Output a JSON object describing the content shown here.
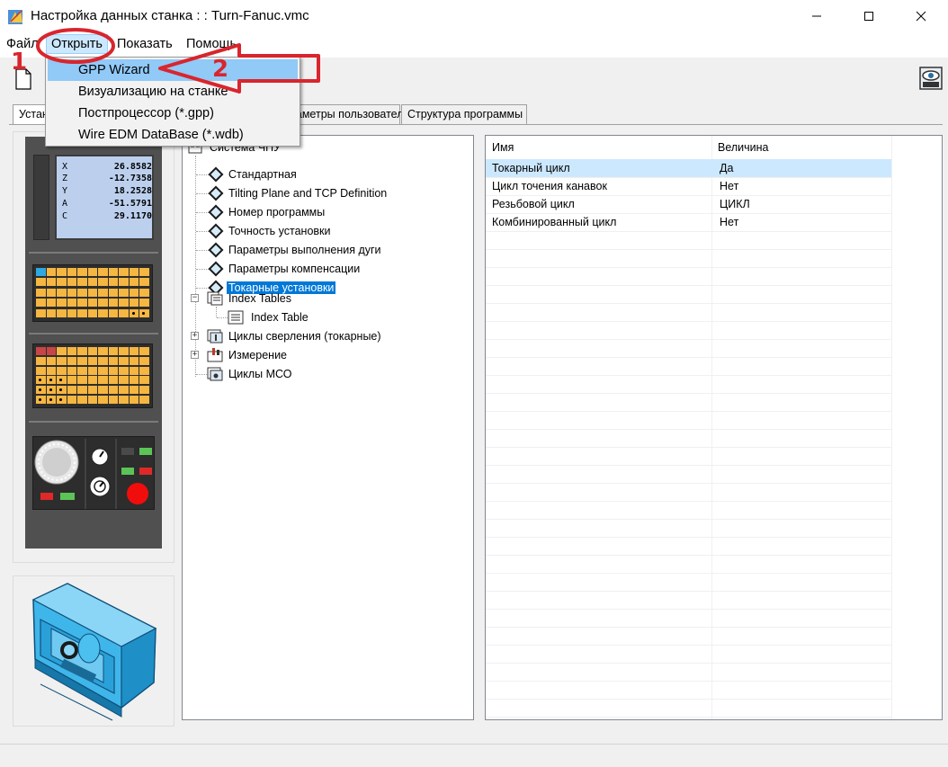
{
  "window": {
    "title": "Настройка данных станка : : Turn-Fanuc.vmc"
  },
  "menu": {
    "file": "Файл",
    "open": "Открыть",
    "show": "Показать",
    "help": "Помощь"
  },
  "dropdown": {
    "items": [
      "GPP Wizard",
      "Визуализацию на станке",
      "Постпроцессор (*.gpp)",
      "Wire EDM DataBase (*.wdb)"
    ]
  },
  "tabs": [
    "Установки",
    "Параметры пользователя",
    "Структура программы"
  ],
  "cnc_readout": [
    {
      "axis": "X",
      "value": "26.8582"
    },
    {
      "axis": "Z",
      "value": "-12.7358"
    },
    {
      "axis": "Y",
      "value": "18.2528"
    },
    {
      "axis": "A",
      "value": "-51.5791"
    },
    {
      "axis": "C",
      "value": "29.1170"
    }
  ],
  "tree": {
    "root": "Система ЧПУ",
    "children": [
      "Стандартная",
      "Tilting Plane and TCP Definition",
      "Номер программы",
      "Точность установки",
      "Параметры выполнения дуги",
      "Параметры компенсации",
      "Токарные установки"
    ],
    "index_tables": "Index Tables",
    "index_table": "Index Table",
    "drilling": "Циклы сверления (токарные)",
    "measurement": "Измерение",
    "mco": "Циклы МСО"
  },
  "grid": {
    "headers": [
      "Имя",
      "Величина"
    ],
    "rows": [
      {
        "name": "Токарный цикл",
        "value": "Да"
      },
      {
        "name": "Цикл точения канавок",
        "value": "Нет"
      },
      {
        "name": "Резьбовой цикл",
        "value": "ЦИКЛ"
      },
      {
        "name": "Комбинированный цикл",
        "value": "Нет"
      }
    ]
  },
  "annotations": {
    "step1": "1",
    "step2": "2"
  },
  "colors": {
    "selection": "#0078d7",
    "row_highlight": "#cce8ff",
    "annotation": "#d9252d",
    "menu_hover": "#91c9f7"
  }
}
